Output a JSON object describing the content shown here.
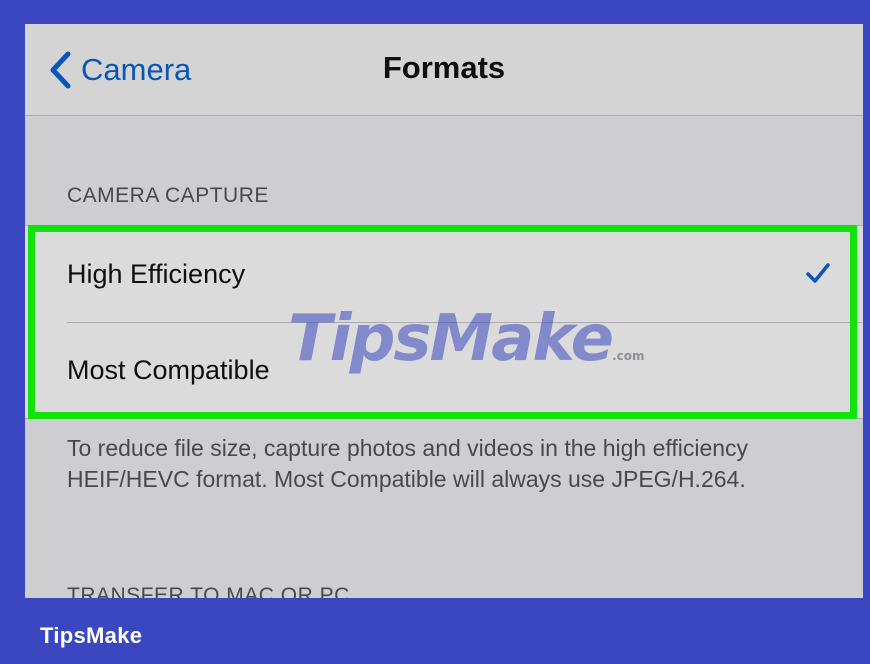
{
  "nav": {
    "back_label": "Camera",
    "title": "Formats"
  },
  "sections": {
    "camera_capture": {
      "header": "CAMERA CAPTURE",
      "options": [
        {
          "label": "High Efficiency",
          "selected": true
        },
        {
          "label": "Most Compatible",
          "selected": false
        }
      ],
      "footer": "To reduce file size, capture photos and videos in the high efficiency HEIF/HEVC format. Most Compatible will always use JPEG/H.264."
    },
    "transfer": {
      "header": "TRANSFER TO MAC OR PC"
    }
  },
  "watermark": {
    "text_tips": "Tips",
    "text_make": "Make",
    "text_domain": ".com"
  },
  "brand": {
    "label": "TipsMake"
  },
  "colors": {
    "frame": "#3a47c0",
    "highlight": "#11e20b",
    "accent": "#0a63d6"
  },
  "icons": {
    "back": "chevron-left-icon",
    "selected": "checkmark-icon"
  }
}
